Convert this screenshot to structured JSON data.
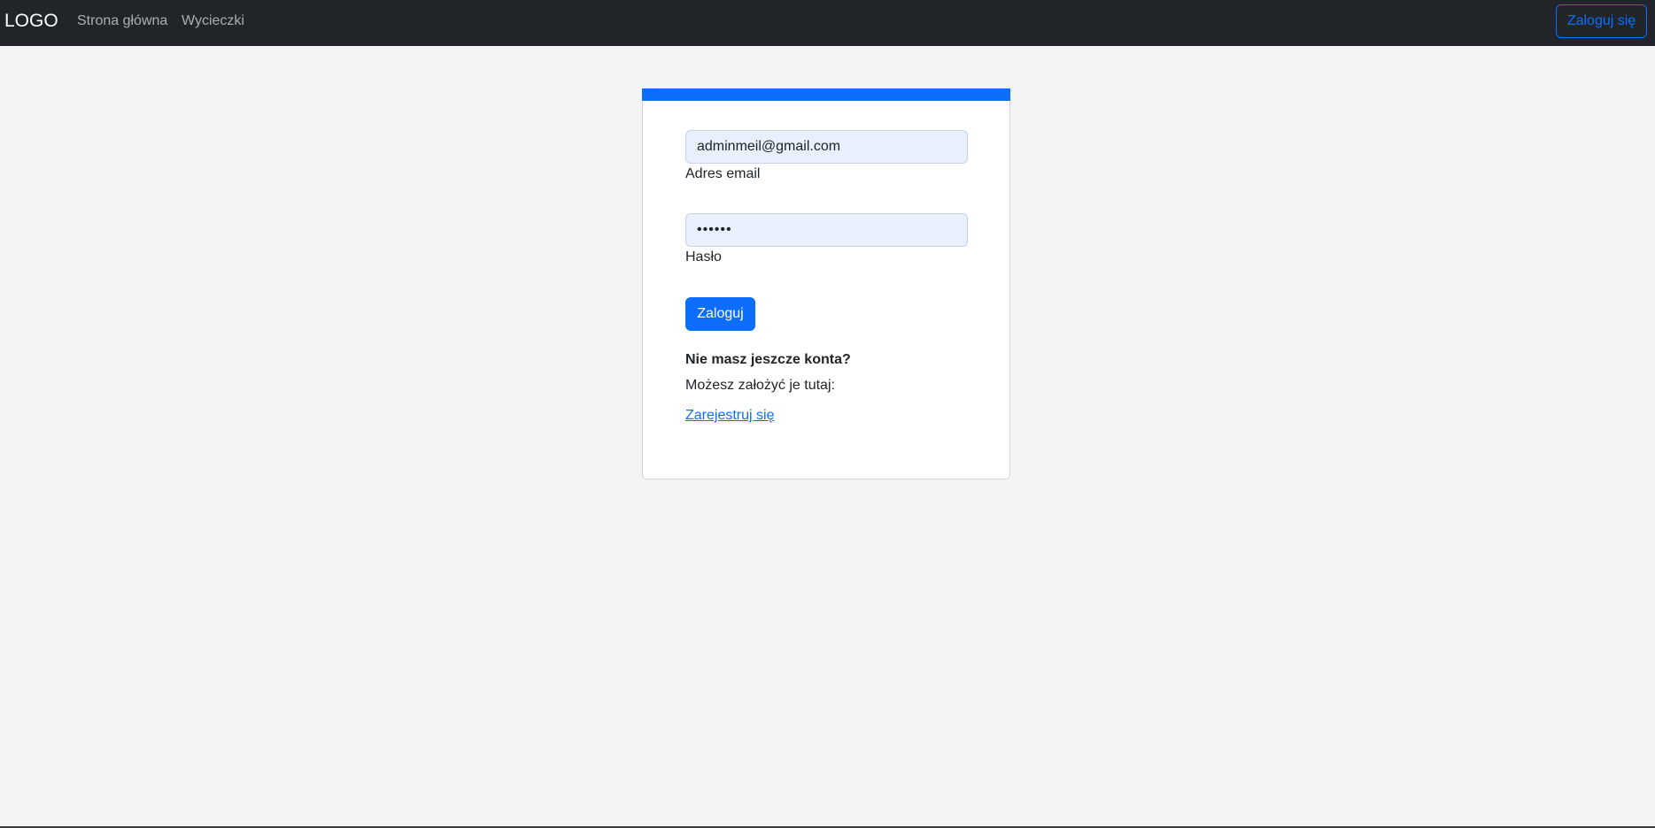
{
  "navbar": {
    "brand": "LOGO",
    "links": [
      {
        "label": "Strona główna"
      },
      {
        "label": "Wycieczki"
      }
    ],
    "login_button": "Zaloguj się"
  },
  "login_form": {
    "email": {
      "value": "adminmeil@gmail.com",
      "label": "Adres email"
    },
    "password": {
      "value": "••••••",
      "label": "Hasło"
    },
    "submit_label": "Zaloguj",
    "no_account_heading": "Nie masz jeszcze konta?",
    "no_account_text": "Możesz założyć je tutaj:",
    "register_link": "Zarejestruj się"
  },
  "colors": {
    "navbar_bg": "#212529",
    "accent": "#0d6efd",
    "page_bg": "#f4f4f4",
    "input_bg": "#e8f0fe"
  }
}
